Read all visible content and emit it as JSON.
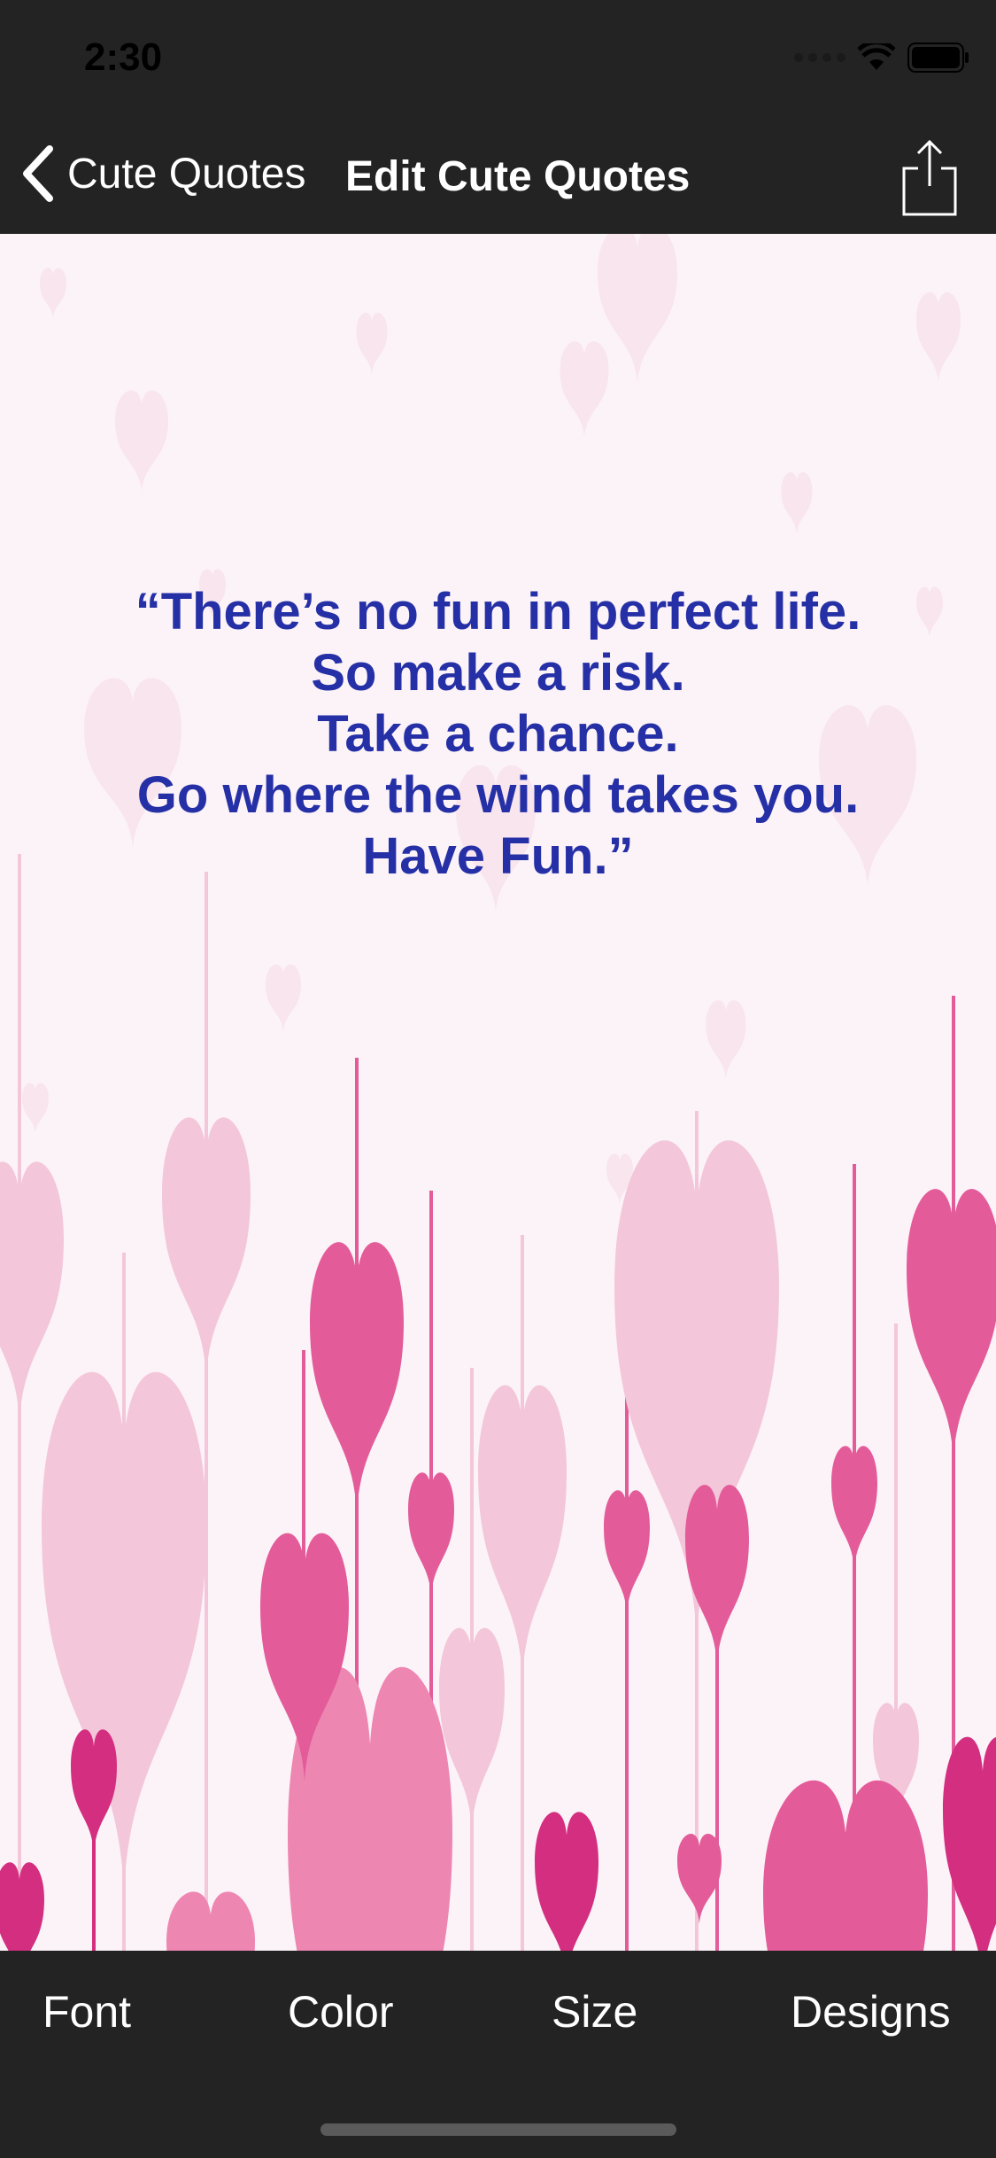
{
  "status_bar": {
    "time": "2:30"
  },
  "nav": {
    "back_label": "Cute Quotes",
    "title": "Edit Cute Quotes",
    "back_icon": "chevron-left-icon",
    "share_icon": "share-icon"
  },
  "quote": {
    "lines": [
      "“There’s no fun in perfect life.",
      "So make a risk.",
      "Take a chance.",
      "Go where the wind takes you.",
      "Have Fun.”"
    ],
    "color": "#2630a6"
  },
  "background": {
    "theme": "pink-hearts",
    "base_color": "#fcf3f8"
  },
  "tabs": [
    {
      "label": "Font"
    },
    {
      "label": "Color"
    },
    {
      "label": "Size"
    },
    {
      "label": "Designs"
    }
  ]
}
